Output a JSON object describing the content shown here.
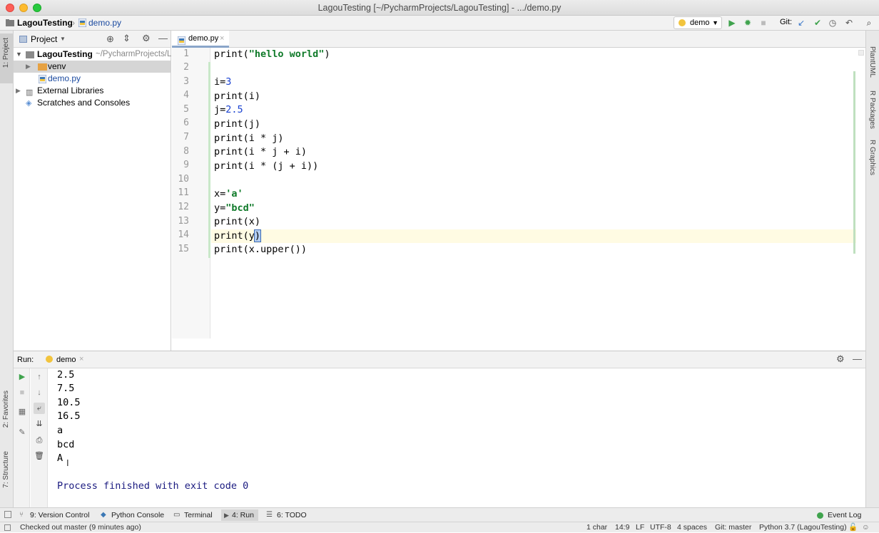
{
  "window": {
    "title": "LagouTesting [~/PycharmProjects/LagouTesting] - .../demo.py"
  },
  "navbar": {
    "project_crumb": "LagouTesting",
    "file_crumb": "demo.py",
    "run_config": "demo",
    "git_label": "Git:"
  },
  "left_strip": {
    "project_tab": "1: Project",
    "favorites_tab": "2: Favorites",
    "structure_tab": "7: Structure"
  },
  "right_strip": {
    "plantuml": "PlantUML",
    "r_packages": "R Packages",
    "r_graphics": "R Graphics"
  },
  "project_panel": {
    "header": "Project",
    "tree": [
      {
        "label": "LagouTesting",
        "suffix": "~/PycharmProjects/L",
        "type": "root"
      },
      {
        "label": "venv",
        "type": "folder"
      },
      {
        "label": "demo.py",
        "type": "python-file"
      },
      {
        "label": "External Libraries",
        "type": "library"
      },
      {
        "label": "Scratches and Consoles",
        "type": "scratch"
      }
    ]
  },
  "editor": {
    "tab_label": "demo.py",
    "line_numbers": [
      "1",
      "2",
      "3",
      "4",
      "5",
      "6",
      "7",
      "8",
      "9",
      "10",
      "11",
      "12",
      "13",
      "14",
      "15"
    ],
    "current_line": 14
  },
  "run_panel": {
    "label": "Run:",
    "tab": "demo",
    "output": [
      "2.5",
      "7.5",
      "10.5",
      "16.5",
      "a",
      "bcd",
      "A",
      ""
    ],
    "finish_message": "Process finished with exit code 0"
  },
  "bottom_tabs": [
    {
      "label": "9: Version Control"
    },
    {
      "label": "Python Console"
    },
    {
      "label": "Terminal"
    },
    {
      "label": "4: Run"
    },
    {
      "label": "6: TODO"
    },
    {
      "label": "Event Log"
    }
  ],
  "status": {
    "message": "Checked out master (9 minutes ago)",
    "selection": "1 char",
    "position": "14:9",
    "line_sep": "LF",
    "encoding": "UTF-8",
    "indent": "4 spaces",
    "git_branch": "Git: master",
    "interpreter": "Python 3.7 (LagouTesting)"
  },
  "colors": {
    "string": "#0f7a29",
    "number": "#1a42d1",
    "run_green": "#3fa34d",
    "finish_text": "#1a1a80"
  }
}
